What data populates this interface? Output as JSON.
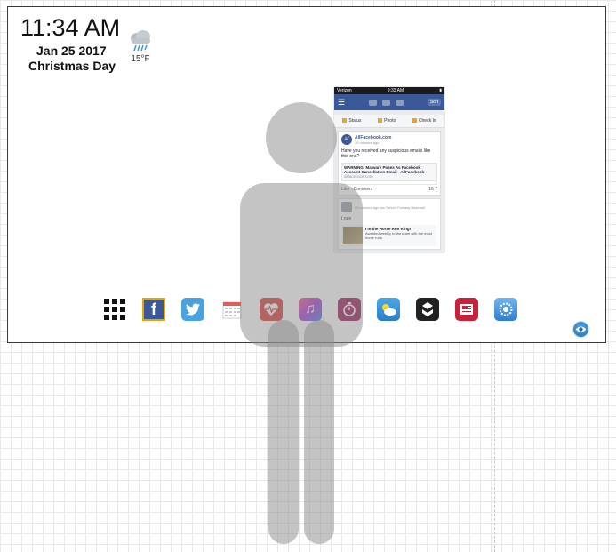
{
  "clock": {
    "time": "11:34 AM",
    "date": "Jan 25 2017",
    "holiday": "Christmas Day"
  },
  "weather": {
    "icon": "rain-cloud-icon",
    "temperature": "15°F"
  },
  "phone_screenshot": {
    "status_bar": {
      "carrier": "Verizon",
      "time": "9:33 AM"
    },
    "nav": {
      "sort_label": "Sort"
    },
    "actions": [
      "Status",
      "Photo",
      "Check In"
    ],
    "post1": {
      "avatar_text": "af",
      "author": "AllFacebook.com",
      "meta": "35 minutes ago",
      "body": "Have you received any suspicious emails like this one?",
      "link_title": "WARNING: Malware Poses As Facebook Account-Cancellation Email - AllFacebook",
      "link_domain": "allfacebook.com",
      "like": "Like",
      "comment": "Comment",
      "counts": "16  7"
    },
    "post2": {
      "meta": "25 minutes ago via Yahoo! Fantasy Baseball",
      "body": "I rule",
      "award_title": "I'm the Horse Run King!",
      "award_text": "Awarded weekly to the team with the most home runs."
    }
  },
  "dock": {
    "apps": [
      {
        "name": "apps-grid-icon",
        "color": "#111111"
      },
      {
        "name": "facebook-icon",
        "color": "#3b5998",
        "selected_border": "#e0a800"
      },
      {
        "name": "twitter-icon",
        "color": "#4aa3df"
      },
      {
        "name": "calendar-icon",
        "color": "#d9d9d9"
      },
      {
        "name": "health-icon",
        "color": "#d9413a"
      },
      {
        "name": "music-icon",
        "color": "#a63bd6"
      },
      {
        "name": "timer-icon",
        "color": "#9c1f5b"
      },
      {
        "name": "weather-icon",
        "color": "#3d9ad8"
      },
      {
        "name": "500px-icon",
        "color": "#222222"
      },
      {
        "name": "news-icon",
        "color": "#c7223b"
      },
      {
        "name": "settings-icon",
        "color": "#3a8dde"
      }
    ]
  },
  "eye_button": {
    "icon": "eye-icon"
  }
}
